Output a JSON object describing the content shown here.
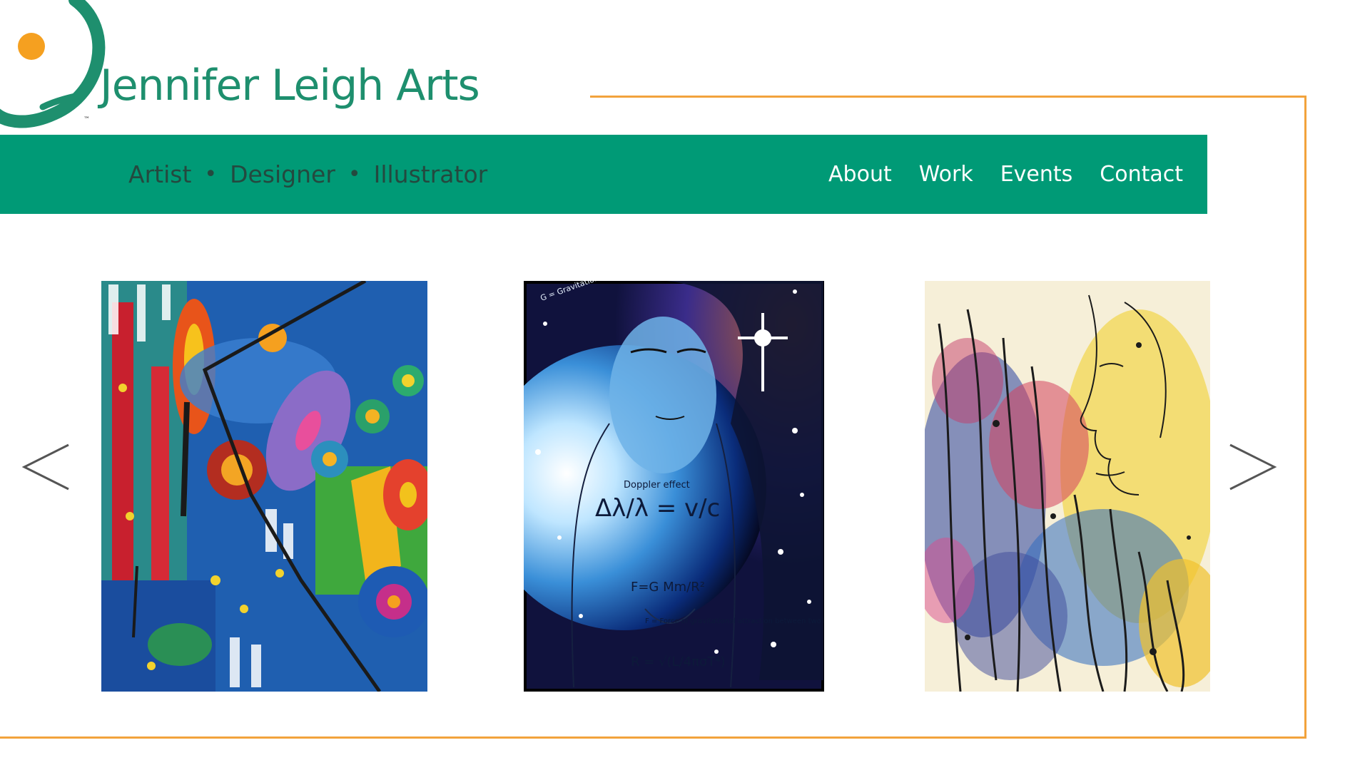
{
  "brand": {
    "title": "Jennifer Leigh Arts",
    "trademark": "™",
    "colors": {
      "primary": "#009a76",
      "title": "#1e8f6e",
      "accent": "#f2a33c",
      "logo_dot": "#f5a020"
    }
  },
  "nav": {
    "tagline": {
      "items": [
        "Artist",
        "Designer",
        "Illustrator"
      ],
      "separator": "•"
    },
    "links": [
      "About",
      "Work",
      "Events",
      "Contact"
    ]
  },
  "carousel": {
    "prev_icon": "chevron-left-icon",
    "next_icon": "chevron-right-icon",
    "artworks": [
      {
        "name": "abstract-colorful-painting"
      },
      {
        "name": "blue-portrait-physics-equations"
      },
      {
        "name": "ink-splatter-portrait"
      }
    ],
    "formulas": [
      "Δλ/λ = v/c",
      "F=G Mm/R²",
      "F = Force of gravitational attraction between two bodies",
      "R = √(L/4πσT⁴)",
      "G = Gravitational Constant",
      "Doppler effect"
    ]
  }
}
